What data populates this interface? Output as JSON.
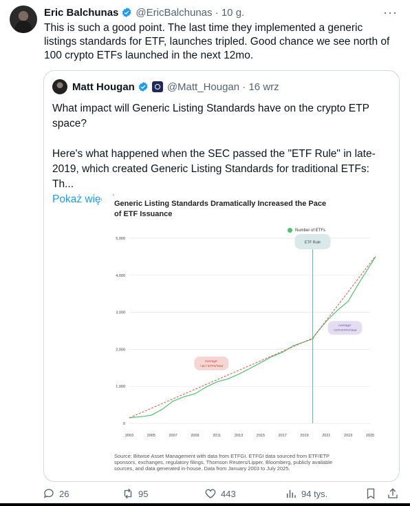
{
  "tweet": {
    "author_name": "Eric Balchunas",
    "handle": "@EricBalchunas",
    "time": "10 g.",
    "text": "This is such a good point. The last time they implemented a generic listings standards for ETF, launches tripled. Good chance we see north of 100 crypto ETFs launched in the next 12mo."
  },
  "quote": {
    "author_name": "Matt Hougan",
    "handle": "@Matt_Hougan",
    "time": "16 wrz",
    "text_line1": "What impact will Generic Listing Standards have on the crypto ETP space?",
    "text_line2": "Here's what happened when the SEC passed the \"ETF Rule\" in late-2019, which created Generic Listing Standards for traditional ETFs: Th...",
    "show_more": "Pokaż więcej"
  },
  "actions": {
    "replies": "26",
    "reposts": "95",
    "likes": "443",
    "views": "94 tys."
  },
  "icons": [
    "more-icon",
    "verified-icon",
    "reply-icon",
    "repost-icon",
    "like-icon",
    "views-icon",
    "bookmark-icon",
    "share-icon"
  ],
  "colors": {
    "link": "#1d9bf0",
    "verified": "#1d9bf0",
    "series": "#4cc36a",
    "trend": "#e0524a"
  },
  "chart_data": {
    "type": "line",
    "title": "Generic Listing Standards Dramatically Increased the Pace of ETF Issuance",
    "legend": "Number of ETFs",
    "legend_position": "top-right",
    "x_ticks": [
      "2003",
      "2005",
      "2007",
      "2009",
      "2011",
      "2013",
      "2015",
      "2017",
      "2019",
      "2021",
      "2023",
      "2025"
    ],
    "y_ticks": [
      "0",
      "1,000",
      "2,000",
      "3,000",
      "4,000",
      "5,000"
    ],
    "xlim": [
      2003,
      2025
    ],
    "ylim": [
      0,
      5000
    ],
    "grid": true,
    "series": [
      {
        "name": "Number of ETFs",
        "x": [
          2003,
          2004,
          2005,
          2006,
          2007,
          2008,
          2009,
          2010,
          2011,
          2012,
          2013,
          2014,
          2015,
          2016,
          2017,
          2018,
          2019,
          2019.75,
          2020,
          2021,
          2022,
          2023,
          2024,
          2025.5
        ],
        "y": [
          150,
          180,
          220,
          380,
          600,
          720,
          800,
          980,
          1120,
          1200,
          1330,
          1480,
          1640,
          1800,
          1920,
          2100,
          2200,
          2280,
          2400,
          2760,
          3050,
          3300,
          3800,
          4500
        ]
      }
    ],
    "trends": [
      {
        "label_line1": "Average:",
        "label_line2": "+117 ETFs/Year",
        "x": [
          2003,
          2019.75
        ],
        "y": [
          150,
          2300
        ]
      },
      {
        "label_line1": "Average:",
        "label_line2": "+370 ETFs/Year",
        "x": [
          2019.75,
          2025.5
        ],
        "y": [
          2300,
          4520
        ]
      }
    ],
    "annotation": {
      "text": "ETF Rule",
      "x": 2019.75
    },
    "source": "Source: Bitwise Asset Management with data from ETFGI. ETFGI data sourced from ETF/ETP sponsors, exchanges, regulatory filings, Thomson Reuters/Lipper, Bloomberg, publicly available sources, and data generated in-house. Data from January 2003 to July 2025."
  }
}
